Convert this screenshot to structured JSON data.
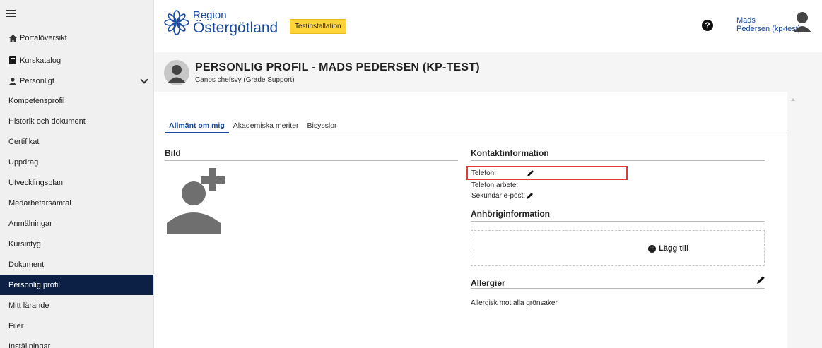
{
  "sidebar": {
    "items": [
      {
        "label": "Portalöversikt",
        "icon": "home-icon"
      },
      {
        "label": "Kurskatalog",
        "icon": "book-icon"
      },
      {
        "label": "Personligt",
        "icon": "user-icon"
      },
      {
        "label": "Kompetensprofil"
      },
      {
        "label": "Historik och dokument"
      },
      {
        "label": "Certifikat"
      },
      {
        "label": "Uppdrag"
      },
      {
        "label": "Utvecklingsplan"
      },
      {
        "label": "Medarbetarsamtal"
      },
      {
        "label": "Anmälningar"
      },
      {
        "label": "Kursintyg"
      },
      {
        "label": "Dokument"
      },
      {
        "label": "Personlig profil",
        "active": true
      },
      {
        "label": "Mitt lärande"
      },
      {
        "label": "Filer"
      },
      {
        "label": "Inställningar"
      }
    ]
  },
  "header": {
    "logo_line1": "Region",
    "logo_line2": "Östergötland",
    "badge": "Testinstallation",
    "help": "?",
    "user_line1": "Mads",
    "user_line2": "Pedersen (kp-test)"
  },
  "profile": {
    "title": "PERSONLIG PROFIL - MADS PEDERSEN (KP-TEST)",
    "subtitle": "Canos chefsvy (Grade Support)"
  },
  "tabs": [
    {
      "label": "Allmänt om mig",
      "active": true
    },
    {
      "label": "Akademiska meriter"
    },
    {
      "label": "Bisysslor"
    }
  ],
  "sections": {
    "bild": "Bild",
    "kontakt": "Kontaktinformation",
    "telefon": "Telefon:",
    "telefon_arbete": "Telefon arbete:",
    "sekundar_epost": "Sekundär e-post:",
    "anhorig": "Anhöriginformation",
    "add": "Lägg till",
    "allergier": "Allergier",
    "allergier_text": "Allergisk mot alla grönsaker"
  },
  "colors": {
    "brand": "#1a4aa0",
    "sidebar_active": "#0c1f45",
    "badge": "#ffd43b",
    "highlight": "#e53935"
  }
}
